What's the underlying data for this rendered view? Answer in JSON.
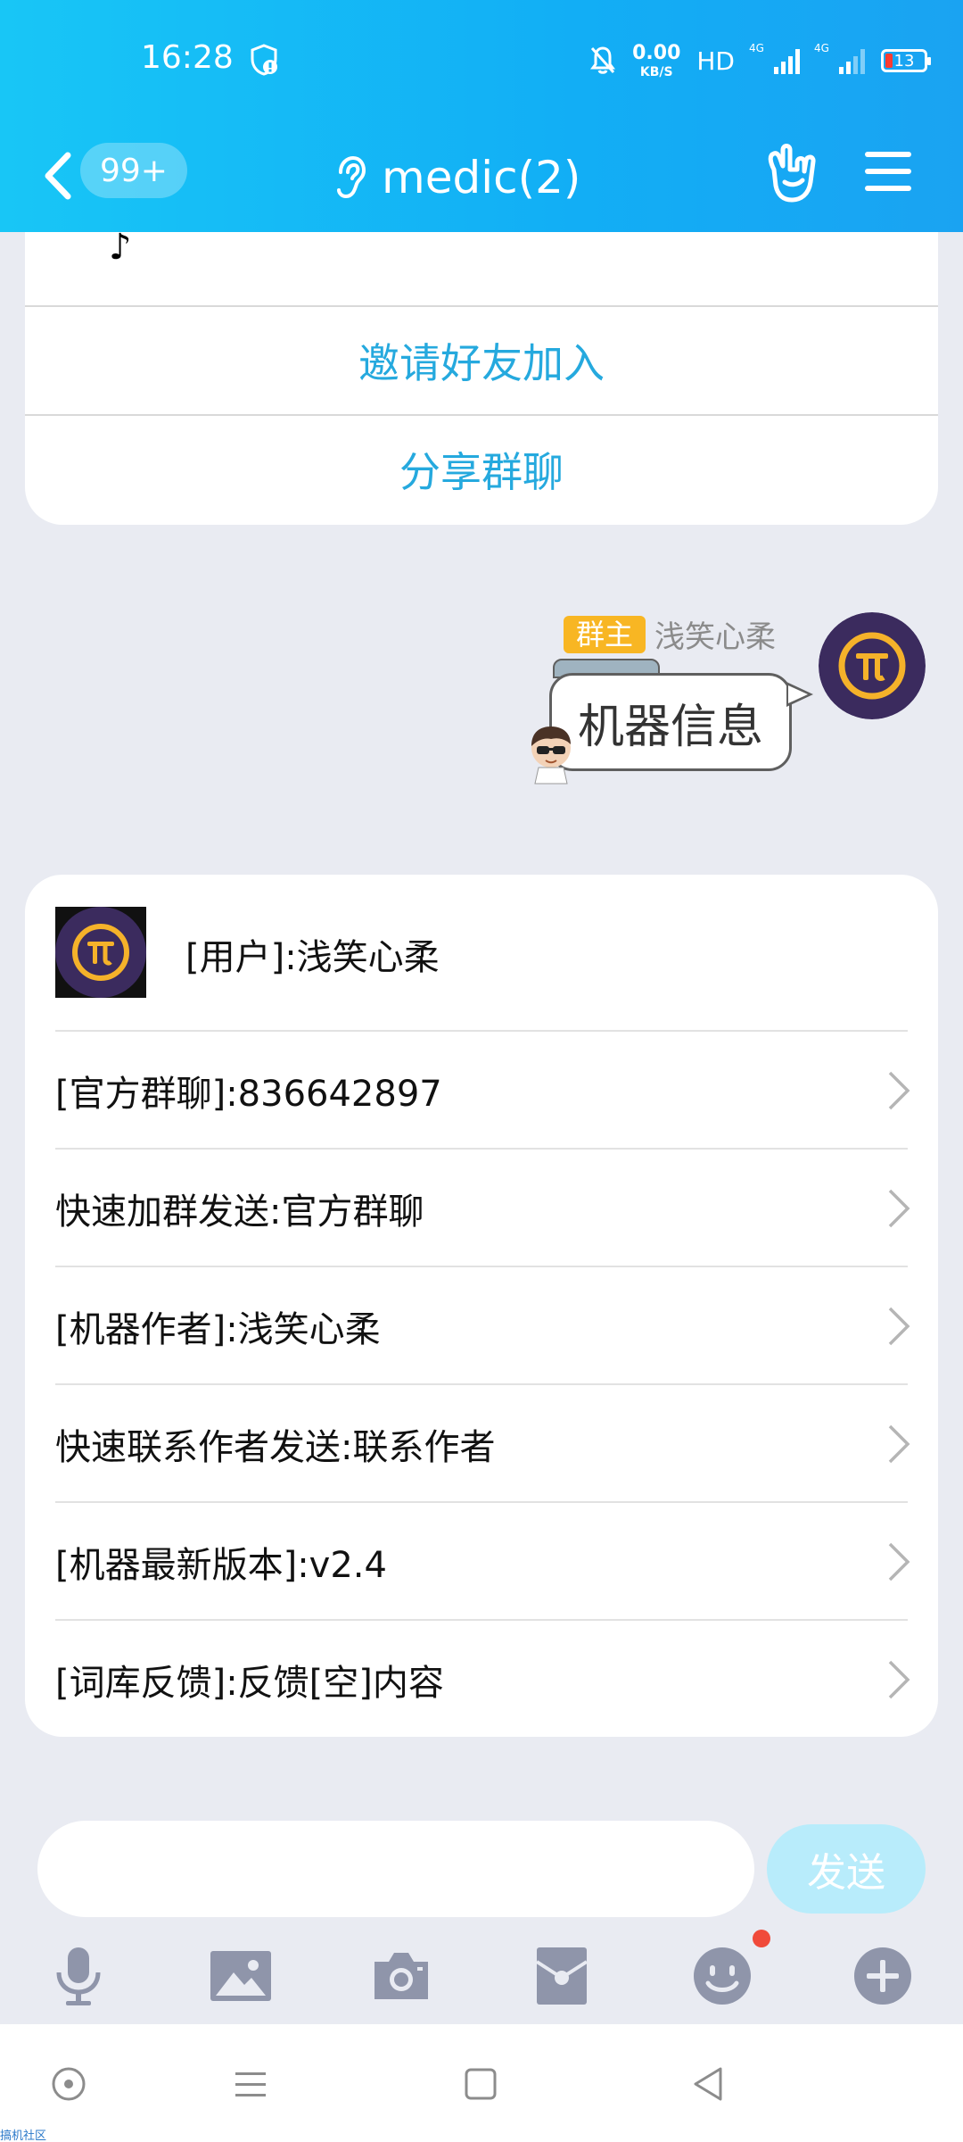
{
  "status_bar": {
    "time": "16:28",
    "net_speed_value": "0.00",
    "net_speed_unit": "KB/S",
    "hd_label": "HD",
    "signal1_label": "4G",
    "signal2_label": "4G",
    "battery": "13",
    "icons": [
      "shield-icon",
      "mute-bell-icon",
      "signal-icon",
      "battery-icon"
    ]
  },
  "nav": {
    "unread_badge": "99+",
    "title": "medic(2)",
    "icons": [
      "back-chevron-icon",
      "ear-icon",
      "rock-hand-icon",
      "menu-icon"
    ]
  },
  "card1": {
    "partial_glyph": "♪",
    "invite_label": "邀请好友加入",
    "share_label": "分享群聊"
  },
  "message": {
    "owner_tag": "群主",
    "sender_name": "浅笑心柔",
    "text": "机器信息"
  },
  "bot_card": {
    "user_line": "[用户]:浅笑心柔",
    "items": [
      "[官方群聊]:836642897",
      "快速加群发送:官方群聊",
      "[机器作者]:浅笑心柔",
      "快速联系作者发送:联系作者",
      "[机器最新版本]:v2.4",
      "[词库反馈]:反馈[空]内容"
    ]
  },
  "composer": {
    "input_value": "",
    "send_label": "发送",
    "tools": [
      "microphone-icon",
      "image-icon",
      "camera-icon",
      "red-packet-icon",
      "emoji-icon",
      "plus-icon"
    ]
  },
  "system_nav": {
    "icons": [
      "assistant-dot-icon",
      "recent-menu-icon",
      "home-square-icon",
      "back-triangle-icon"
    ]
  },
  "watermark": "搞机社区",
  "colors": {
    "header_gradient_start": "#18c6f6",
    "header_gradient_end": "#1aa3f2",
    "link_blue": "#25a9de",
    "owner_tag": "#f8b623",
    "pi_purple": "#3b2b5e",
    "pi_gold": "#f5b22a",
    "send_button": "#b8ecfb"
  }
}
